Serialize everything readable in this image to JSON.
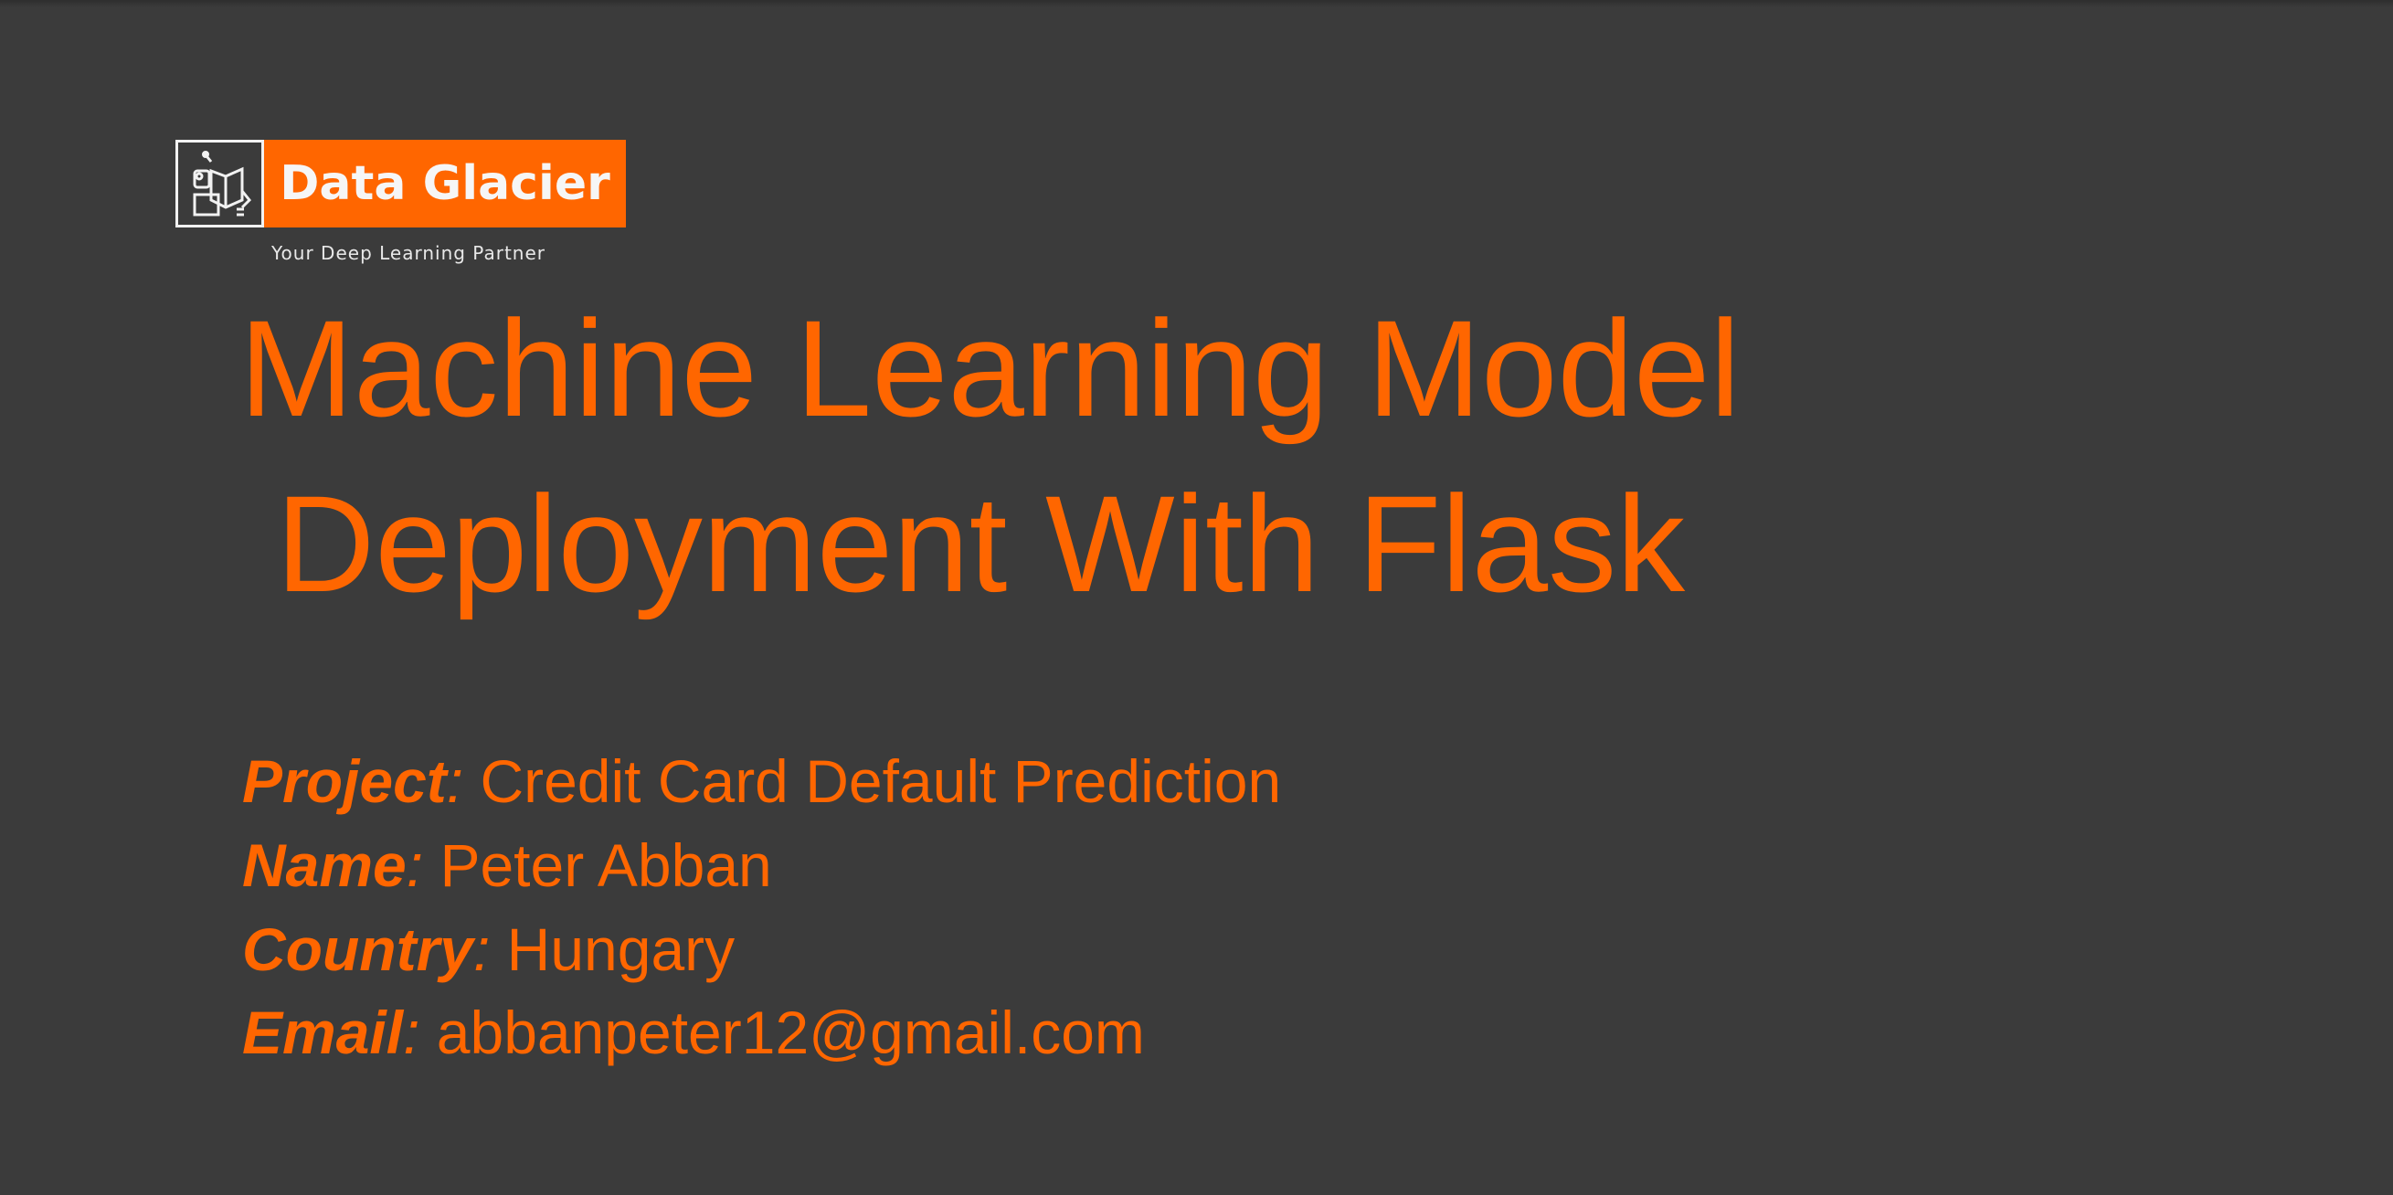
{
  "logo": {
    "name": "Data Glacier",
    "tagline": "Your Deep Learning Partner",
    "icon": "robot-reading-book-icon",
    "brand_color": "#FF6600"
  },
  "title": {
    "line1": "Machine Learning Model",
    "line2": "Deployment With Flask"
  },
  "details": [
    {
      "label": "Project",
      "value": "Credit Card Default Prediction"
    },
    {
      "label": "Name",
      "value": "Peter Abban"
    },
    {
      "label": "Country",
      "value": "Hungary"
    },
    {
      "label": "Email",
      "value": "abbanpeter12@gmail.com"
    }
  ],
  "colors": {
    "background": "#3B3B3B",
    "accent": "#FF6600"
  }
}
